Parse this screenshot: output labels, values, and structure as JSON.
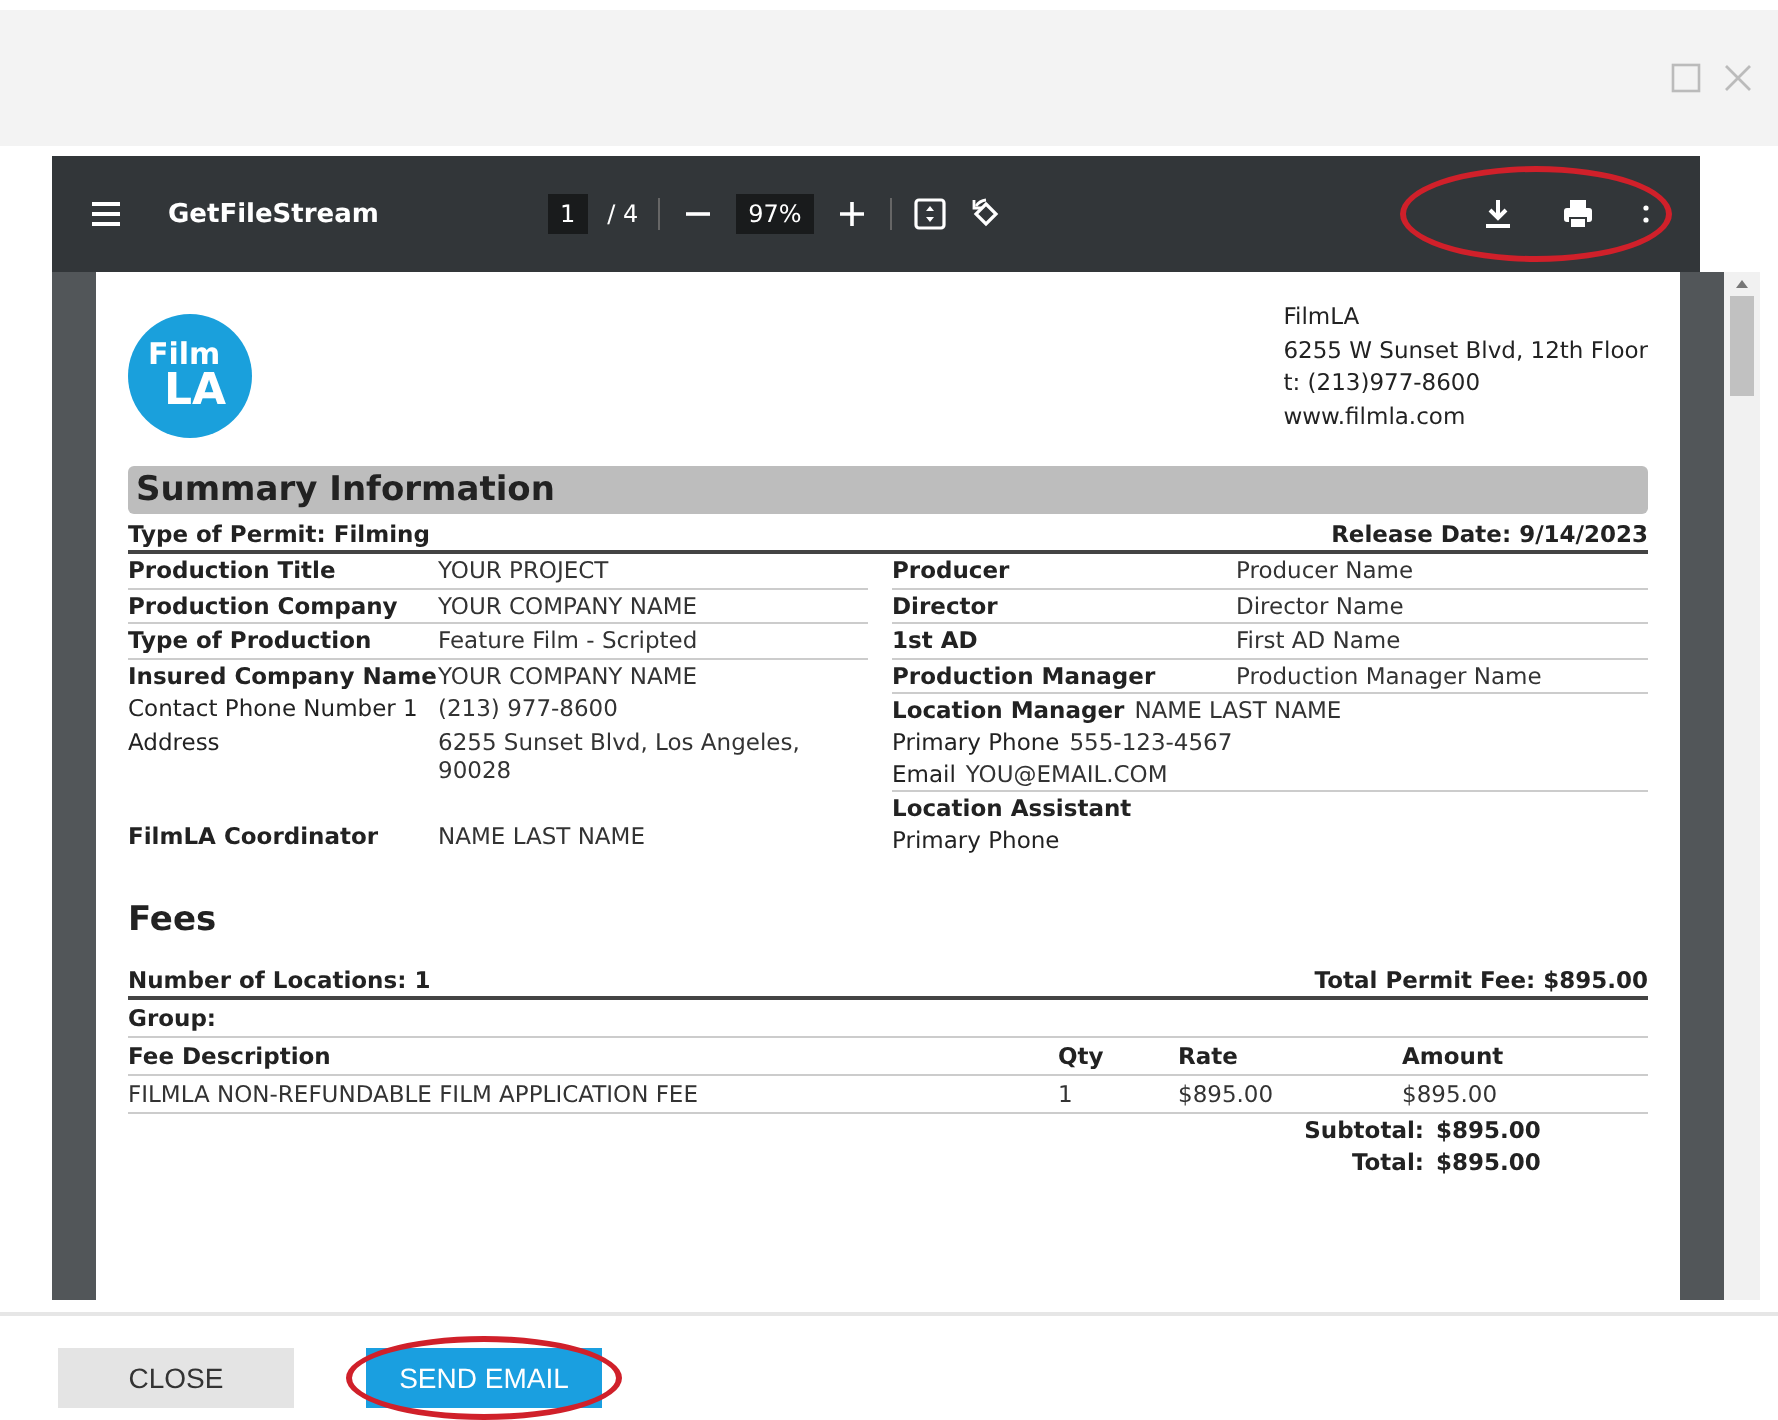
{
  "toolbar": {
    "title": "GetFileStream",
    "page": "1",
    "page_total": "/ 4",
    "zoom": "97%",
    "actions_highlighted": true
  },
  "document": {
    "logo": {
      "line1": "Film",
      "line2": "LA"
    },
    "address": [
      "FilmLA",
      "6255 W Sunset Blvd, 12th Floor",
      "t: (213)977-8600",
      "www.filmla.com"
    ],
    "section_title": "Summary Information",
    "permit_type": "Type of Permit: Filming",
    "release_date": "Release Date: 9/14/2023",
    "left_rows": [
      {
        "label": "Production Title",
        "value": "YOUR PROJECT",
        "bold": true
      },
      {
        "label": "Production Company",
        "value": "YOUR COMPANY NAME",
        "bold": true
      },
      {
        "label": "Type of Production",
        "value": "Feature Film - Scripted",
        "bold": true
      },
      {
        "label": "Insured Company Name",
        "value": "YOUR COMPANY NAME",
        "bold": true
      },
      {
        "label": "Contact Phone Number 1",
        "value": "(213) 977-8600",
        "bold": false
      },
      {
        "label": "Address",
        "value": "6255 Sunset Blvd, Los Angeles, 90028",
        "bold": false
      }
    ],
    "coordinator": {
      "label": "FilmLA Coordinator",
      "value": "NAME LAST NAME"
    },
    "right_rows": [
      {
        "kind": "field",
        "label": "Producer",
        "value": "Producer Name",
        "bold": true
      },
      {
        "kind": "field",
        "label": "Director",
        "value": "Director Name",
        "bold": true
      },
      {
        "kind": "field",
        "label": "1st AD",
        "value": "First AD Name",
        "bold": true
      },
      {
        "kind": "field",
        "label": "Production Manager",
        "value": "Production Manager Name",
        "bold": true
      },
      {
        "kind": "inline",
        "label": "Location Manager",
        "value": "NAME LAST  NAME",
        "bold": true
      },
      {
        "kind": "inline",
        "label": "Primary Phone",
        "value": "555-123-4567",
        "bold": false
      },
      {
        "kind": "inline",
        "label": "Email",
        "value": "YOU@EMAIL.COM",
        "bold": false
      },
      {
        "kind": "inline",
        "label": "Location Assistant",
        "bold": true
      },
      {
        "kind": "inline",
        "label": "Primary Phone",
        "bold": false
      }
    ],
    "fees_title": "Fees",
    "locations": "Number of Locations: 1",
    "total_permit_fee": "Total Permit Fee: $895.00",
    "group": "Group:",
    "fee_columns": [
      "Fee Description",
      "Qty",
      "Rate",
      "Amount"
    ],
    "fee_rows": [
      [
        "FILMLA NON-REFUNDABLE FILM APPLICATION FEE",
        "1",
        "$895.00",
        "$895.00"
      ]
    ],
    "totals": [
      {
        "label": "Subtotal:",
        "value": "$895.00"
      },
      {
        "label": "Total:",
        "value": "$895.00"
      }
    ]
  },
  "buttons": [
    {
      "label": "CLOSE",
      "kind": "secondary",
      "highlighted": false
    },
    {
      "label": "SEND EMAIL",
      "kind": "primary",
      "highlighted": true
    }
  ]
}
